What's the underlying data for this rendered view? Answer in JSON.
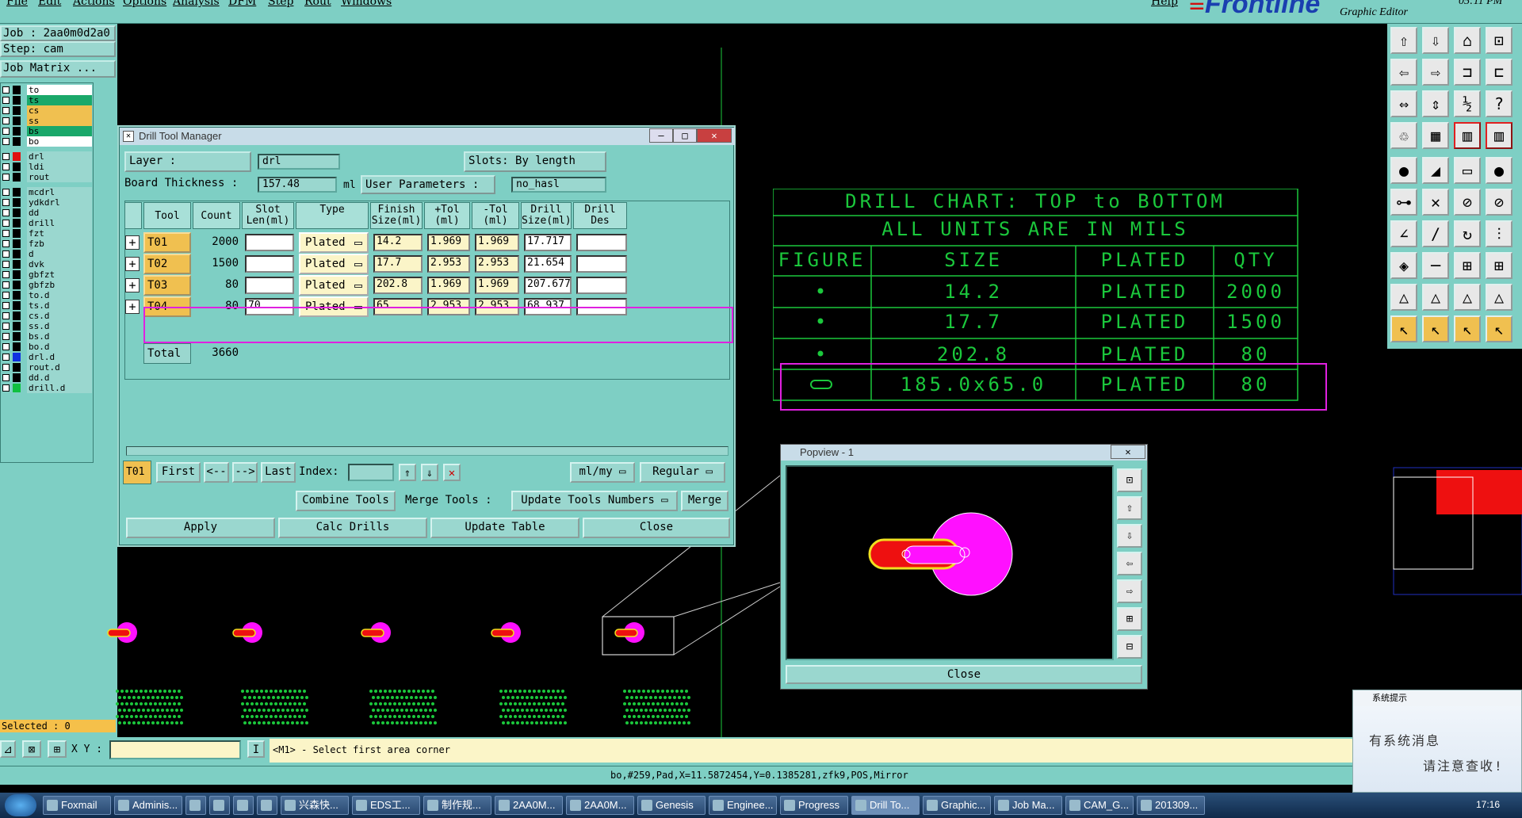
{
  "menubar": {
    "items": [
      "File",
      "Edit",
      "Actions",
      "Options",
      "Analysis",
      "DFM",
      "Step",
      "Rout",
      "Windows"
    ],
    "help": "Help",
    "logo": "Frontline",
    "subtitle": "Graphic Editor",
    "clock": "05:11 PM"
  },
  "left": {
    "job": "Job : 2aa0m0d2a0",
    "step": "Step: cam",
    "job_matrix": "Job Matrix ...",
    "layers": [
      {
        "name": "to",
        "color": "#ffffff",
        "swatch": "#000000"
      },
      {
        "name": "ts",
        "color": "#1aa86a",
        "swatch": "#000000"
      },
      {
        "name": "cs",
        "color": "#f0c050",
        "swatch": "#000000"
      },
      {
        "name": "ss",
        "color": "#f0c050",
        "swatch": "#000000"
      },
      {
        "name": "bs",
        "color": "#1aa86a",
        "swatch": "#000000"
      },
      {
        "name": "bo",
        "color": "#ffffff",
        "swatch": "#000000"
      },
      {
        "name": "drl",
        "color": "#9ad7cf",
        "swatch": "#e01010"
      },
      {
        "name": "ldi",
        "color": "#9ad7cf",
        "swatch": "#000000"
      },
      {
        "name": "rout",
        "color": "#9ad7cf",
        "swatch": "#000000"
      },
      {
        "name": "mcdrl",
        "color": "#9ad7cf",
        "swatch": "#000000"
      },
      {
        "name": "ydkdrl",
        "color": "#9ad7cf",
        "swatch": "#000000"
      },
      {
        "name": "dd",
        "color": "#9ad7cf",
        "swatch": "#000000"
      },
      {
        "name": "drill",
        "color": "#9ad7cf",
        "swatch": "#000000"
      },
      {
        "name": "fzt",
        "color": "#9ad7cf",
        "swatch": "#000000"
      },
      {
        "name": "fzb",
        "color": "#9ad7cf",
        "swatch": "#000000"
      },
      {
        "name": "d",
        "color": "#9ad7cf",
        "swatch": "#000000"
      },
      {
        "name": "dvk",
        "color": "#9ad7cf",
        "swatch": "#000000"
      },
      {
        "name": "gbfzt",
        "color": "#9ad7cf",
        "swatch": "#000000"
      },
      {
        "name": "gbfzb",
        "color": "#9ad7cf",
        "swatch": "#000000"
      },
      {
        "name": "to.d",
        "color": "#9ad7cf",
        "swatch": "#000000"
      },
      {
        "name": "ts.d",
        "color": "#9ad7cf",
        "swatch": "#000000"
      },
      {
        "name": "cs.d",
        "color": "#9ad7cf",
        "swatch": "#000000"
      },
      {
        "name": "ss.d",
        "color": "#9ad7cf",
        "swatch": "#000000"
      },
      {
        "name": "bs.d",
        "color": "#9ad7cf",
        "swatch": "#000000"
      },
      {
        "name": "bo.d",
        "color": "#9ad7cf",
        "swatch": "#000000"
      },
      {
        "name": "drl.d",
        "color": "#9ad7cf",
        "swatch": "#1030e0"
      },
      {
        "name": "rout.d",
        "color": "#9ad7cf",
        "swatch": "#000000"
      },
      {
        "name": "dd.d",
        "color": "#9ad7cf",
        "swatch": "#000000"
      },
      {
        "name": "drill.d",
        "color": "#9ad7cf",
        "swatch": "#10c040"
      }
    ],
    "selected": "Selected : 0"
  },
  "dtm": {
    "title": "Drill Tool Manager",
    "layer_label": "Layer            :",
    "layer_value": "drl",
    "slots_label": "Slots:",
    "slots_value": "By length",
    "thickness_label": "Board Thickness :",
    "thickness_value": "157.48",
    "thickness_unit": "ml",
    "user_params_label": "User Parameters :",
    "user_params_value": "no_hasl",
    "headers": [
      "Tool",
      "Count",
      "Slot\nLen(ml)",
      "Type",
      "Finish\nSize(ml)",
      "+Tol\n(ml)",
      "-Tol\n(ml)",
      "Drill\nSize(ml)",
      "Drill\nDes"
    ],
    "rows": [
      {
        "tool": "T01",
        "count": "2000",
        "slot": "",
        "type": "Plated",
        "finish": "14.2",
        "ptol": "1.969",
        "mtol": "1.969",
        "drill": "17.717",
        "des": ""
      },
      {
        "tool": "T02",
        "count": "1500",
        "slot": "",
        "type": "Plated",
        "finish": "17.7",
        "ptol": "2.953",
        "mtol": "2.953",
        "drill": "21.654",
        "des": ""
      },
      {
        "tool": "T03",
        "count": "80",
        "slot": "",
        "type": "Plated",
        "finish": "202.8",
        "ptol": "1.969",
        "mtol": "1.969",
        "drill": "207.677",
        "des": ""
      },
      {
        "tool": "T04",
        "count": "80",
        "slot": "70",
        "type": "Plated",
        "finish": "65",
        "ptol": "2.953",
        "mtol": "2.953",
        "drill": "68.937",
        "des": ""
      }
    ],
    "total_label": "Total",
    "total_value": "3660",
    "current_tool": "T01",
    "nav": {
      "first": "First",
      "prev": "<--",
      "next": "-->",
      "last": "Last",
      "index": "Index:"
    },
    "units": "ml/my",
    "mode": "Regular",
    "combine": "Combine Tools",
    "merge_label": "Merge Tools :",
    "update_numbers": "Update Tools Numbers",
    "merge": "Merge",
    "apply": "Apply",
    "calc": "Calc Drills",
    "update_table": "Update Table",
    "close": "Close"
  },
  "chart": {
    "title1": "DRILL CHART: TOP to BOTTOM",
    "title2": "ALL UNITS ARE IN MILS",
    "headers": [
      "FIGURE",
      "SIZE",
      "PLATED",
      "QTY"
    ],
    "rows": [
      {
        "fig": "•",
        "size": "14.2",
        "plated": "PLATED",
        "qty": "2000"
      },
      {
        "fig": "•",
        "size": "17.7",
        "plated": "PLATED",
        "qty": "1500"
      },
      {
        "fig": "•",
        "size": "202.8",
        "plated": "PLATED",
        "qty": "80"
      },
      {
        "fig": "slot",
        "size": "185.0x65.0",
        "plated": "PLATED",
        "qty": "80"
      }
    ]
  },
  "popview": {
    "title": "Popview - 1",
    "close": "Close"
  },
  "cmd": {
    "xy_label": "X Y :",
    "prompt": "<M1> - Select first area corner"
  },
  "status": "bo,#259,Pad,X=11.5872454,Y=0.1385281,zfk9,POS,Mirror",
  "notify": {
    "title": "系统提示",
    "line1": "有系统消息",
    "line2": "请注意查收!"
  },
  "taskbar": {
    "items": [
      "Foxmail",
      "Adminis...",
      "",
      "",
      "",
      "",
      "兴森快...",
      "EDS工...",
      "制作规...",
      "2AA0M...",
      "2AA0M...",
      "Genesis",
      "Enginee...",
      "Progress",
      "Drill To...",
      "Graphic...",
      "Job Ma...",
      "CAM_G...",
      "201309..."
    ],
    "time": "17:16"
  }
}
